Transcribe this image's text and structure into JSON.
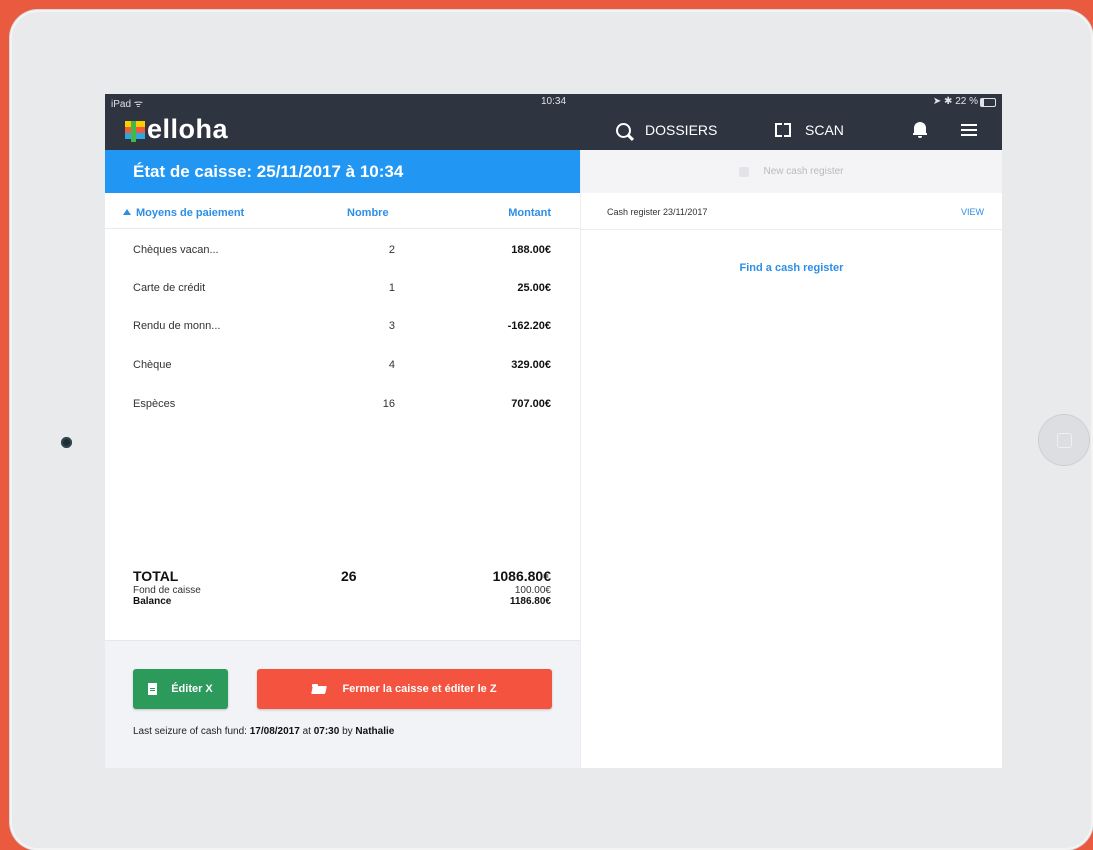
{
  "status_bar": {
    "device": "iPad",
    "time": "10:34",
    "battery": "22 %"
  },
  "navbar": {
    "logo_text": "elloha",
    "dossiers_label": "DOSSIERS",
    "scan_label": "SCAN"
  },
  "left_panel": {
    "title": "État de caisse: 25/11/2017 à 10:34",
    "columns": {
      "payment": "Moyens de paiement",
      "count": "Nombre",
      "amount": "Montant"
    },
    "rows": [
      {
        "method": "Chèques vacan...",
        "count": "2",
        "amount": "188.00€"
      },
      {
        "method": "Carte de crédit",
        "count": "1",
        "amount": "25.00€"
      },
      {
        "method": "Rendu de monn...",
        "count": "3",
        "amount": "-162.20€"
      },
      {
        "method": "Chèque",
        "count": "4",
        "amount": "329.00€"
      },
      {
        "method": "Espèces",
        "count": "16",
        "amount": "707.00€"
      }
    ],
    "totals": {
      "label": "TOTAL",
      "count": "26",
      "amount": "1086.80€",
      "fund_label": "Fond de caisse",
      "fund_value": "100.00€",
      "balance_label": "Balance",
      "balance_value": "1186.80€"
    },
    "buttons": {
      "edit_x": "Éditer X",
      "close_z": "Fermer la caisse et éditer le Z"
    },
    "last_seizure": {
      "prefix": "Last seizure of cash fund:",
      "date": "17/08/2017",
      "at": "at",
      "time": "07:30",
      "by": "by",
      "user": "Nathalie"
    }
  },
  "right_panel": {
    "new_button": "New cash register",
    "register_name": "Cash register 23/11/2017",
    "view_link": "VIEW",
    "find_link": "Find a cash register"
  },
  "colors": {
    "background": "#ea5a3e",
    "navbar": "#2f3540",
    "header_blue": "#2196f3",
    "link_blue": "#2d8ee6",
    "green_button": "#2b9a5a",
    "red_button": "#f3533f"
  }
}
